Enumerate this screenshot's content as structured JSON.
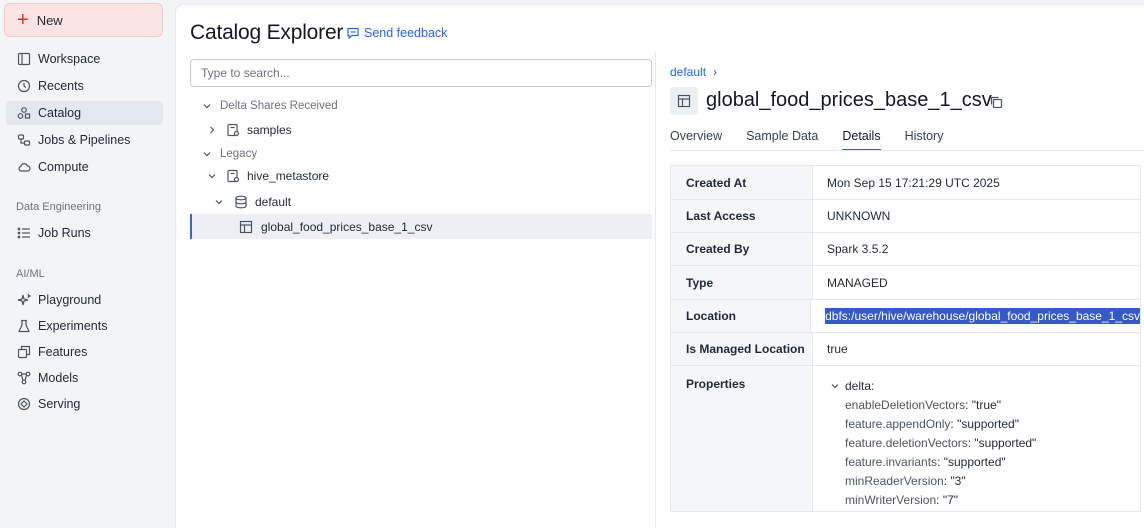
{
  "sidebar": {
    "new_label": "New",
    "items": [
      {
        "label": "Workspace",
        "icon": "workspace-icon"
      },
      {
        "label": "Recents",
        "icon": "clock-icon"
      },
      {
        "label": "Catalog",
        "icon": "catalog-icon"
      },
      {
        "label": "Jobs & Pipelines",
        "icon": "jobs-icon"
      },
      {
        "label": "Compute",
        "icon": "cloud-icon"
      }
    ],
    "section_data_engineering": "Data Engineering",
    "job_runs": "Job Runs",
    "section_aiml": "AI/ML",
    "aiml_items": [
      {
        "label": "Playground",
        "icon": "sparkle-icon"
      },
      {
        "label": "Experiments",
        "icon": "flask-icon"
      },
      {
        "label": "Features",
        "icon": "features-icon"
      },
      {
        "label": "Models",
        "icon": "models-icon"
      },
      {
        "label": "Serving",
        "icon": "serving-icon"
      }
    ]
  },
  "header": {
    "title": "Catalog Explorer",
    "feedback": "Send feedback"
  },
  "search": {
    "placeholder": "Type to search..."
  },
  "tree": {
    "delta_shares": "Delta Shares Received",
    "samples": "samples",
    "legacy": "Legacy",
    "hive_metastore": "hive_metastore",
    "default": "default",
    "table": "global_food_prices_base_1_csv"
  },
  "details": {
    "breadcrumb": "default",
    "breadcrumb_sep": "›",
    "table_name": "global_food_prices_base_1_csv",
    "tabs": [
      "Overview",
      "Sample Data",
      "Details",
      "History"
    ],
    "active_tab": "Details",
    "rows": [
      {
        "key": "Created At",
        "value": "Mon Sep 15 17:21:29 UTC 2025"
      },
      {
        "key": "Last Access",
        "value": "UNKNOWN"
      },
      {
        "key": "Created By",
        "value": "Spark 3.5.2"
      },
      {
        "key": "Type",
        "value": "MANAGED"
      },
      {
        "key": "Location",
        "value": "dbfs:/user/hive/warehouse/global_food_prices_base_1_csv"
      },
      {
        "key": "Is Managed Location",
        "value": "true"
      }
    ],
    "properties_label": "Properties",
    "properties_group": "delta:",
    "properties": [
      {
        "key": "enableDeletionVectors",
        "value": "\"true\""
      },
      {
        "key": "feature.appendOnly",
        "value": "\"supported\""
      },
      {
        "key": "feature.deletionVectors",
        "value": "\"supported\""
      },
      {
        "key": "feature.invariants",
        "value": "\"supported\""
      },
      {
        "key": "minReaderVersion",
        "value": "\"3\""
      },
      {
        "key": "minWriterVersion",
        "value": "\"7\""
      }
    ]
  },
  "colors": {
    "accent": "#2563eb",
    "new_button_bg": "#fde4e4",
    "selection_highlight": "#3559c6"
  }
}
